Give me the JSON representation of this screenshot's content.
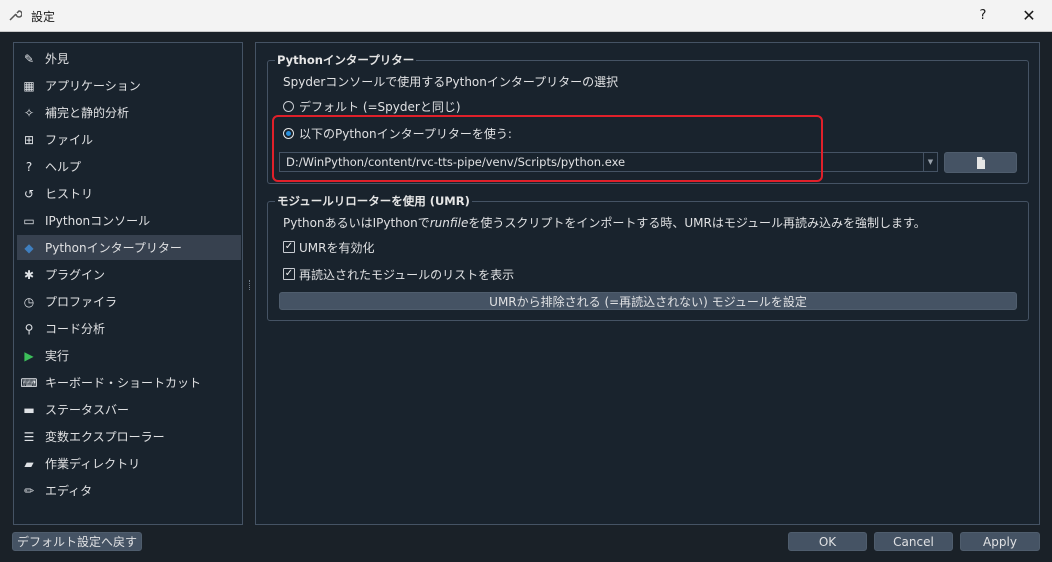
{
  "window": {
    "title": "設定",
    "help_label": "?",
    "close_label": "✕"
  },
  "sidebar": {
    "items": [
      {
        "label": "外見",
        "icon": "brush-icon",
        "glyph": "✎"
      },
      {
        "label": "アプリケーション",
        "icon": "window-layout-icon",
        "glyph": "▦"
      },
      {
        "label": "補完と静的分析",
        "icon": "spark-icon",
        "glyph": "✧"
      },
      {
        "label": "ファイル",
        "icon": "file-tree-icon",
        "glyph": "⊞"
      },
      {
        "label": "ヘルプ",
        "icon": "question-icon",
        "glyph": "?"
      },
      {
        "label": "ヒストリ",
        "icon": "history-icon",
        "glyph": "↺"
      },
      {
        "label": "IPythonコンソール",
        "icon": "terminal-icon",
        "glyph": "▭"
      },
      {
        "label": "Pythonインタープリター",
        "icon": "python-icon",
        "glyph": "◆"
      },
      {
        "label": "プラグイン",
        "icon": "puzzle-icon",
        "glyph": "✱"
      },
      {
        "label": "プロファイラ",
        "icon": "stopwatch-icon",
        "glyph": "◷"
      },
      {
        "label": "コード分析",
        "icon": "magnifier-icon",
        "glyph": "⚲"
      },
      {
        "label": "実行",
        "icon": "play-icon",
        "glyph": "▶"
      },
      {
        "label": "キーボード・ショートカット",
        "icon": "keyboard-icon",
        "glyph": "⌨"
      },
      {
        "label": "ステータスバー",
        "icon": "statusbar-icon",
        "glyph": "▬"
      },
      {
        "label": "変数エクスプローラー",
        "icon": "list-icon",
        "glyph": "☰"
      },
      {
        "label": "作業ディレクトリ",
        "icon": "folder-icon",
        "glyph": "▰"
      },
      {
        "label": "エディタ",
        "icon": "pencil-icon",
        "glyph": "✏"
      }
    ],
    "selected_index": 7
  },
  "interpreter": {
    "group_title": "Pythonインタープリター",
    "description": "Spyderコンソールで使用するPythonインタープリターの選択",
    "default_option": "デフォルト (=Spyderと同じ)",
    "custom_option": "以下のPythonインタープリターを使う:",
    "path_value": "D:/WinPython/content/rvc-tts-pipe/venv/Scripts/python.exe",
    "browse_icon": "file-icon"
  },
  "umr": {
    "group_title": "モジュールリローターを使用 (UMR)",
    "description_prefix": "PythonあるいはIPythonで",
    "description_em": "runfile",
    "description_suffix": "を使うスクリプトをインポートする時、UMRはモジュール再読み込みを強制します。",
    "enable_label": "UMRを有効化",
    "show_list_label": "再読込されたモジュールのリストを表示",
    "exclude_button": "UMRから排除される (=再読込されない) モジュールを設定"
  },
  "footer": {
    "reset_button": "デフォルト設定へ戻す",
    "ok_button": "OK",
    "cancel_button": "Cancel",
    "apply_button": "Apply"
  },
  "colors": {
    "background": "#1a2128",
    "panel": "#19232d",
    "border": "#455364",
    "selected": "#37414f",
    "highlight": "#e0202a",
    "radio_accent": "#2a8fdc"
  }
}
